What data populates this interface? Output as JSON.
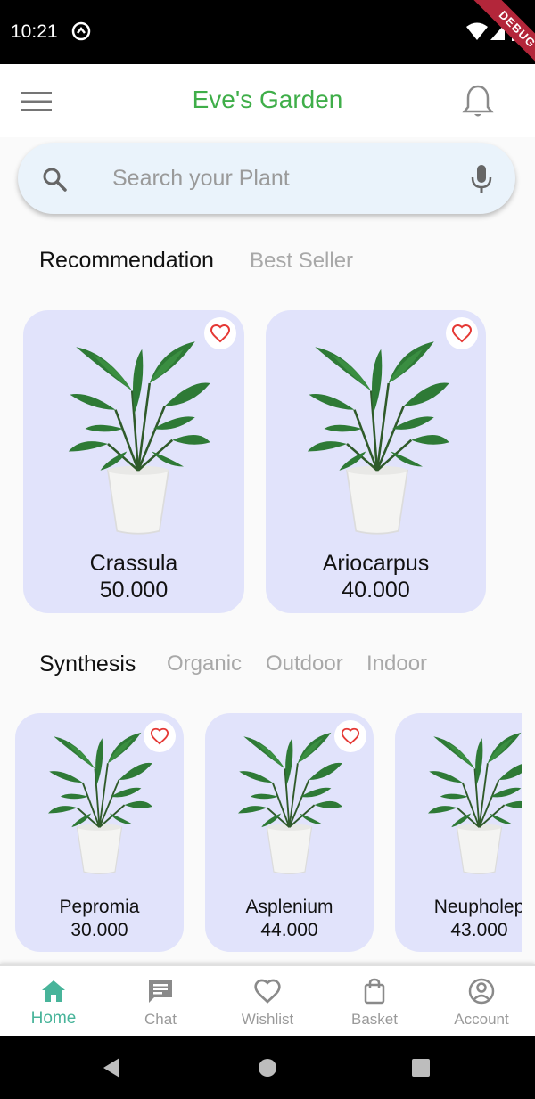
{
  "status_bar": {
    "time": "10:21",
    "debug_label": "DEBUG"
  },
  "app_bar": {
    "title": "Eve's Garden"
  },
  "search": {
    "placeholder": "Search your Plant"
  },
  "recommend_tabs": [
    {
      "label": "Recommendation",
      "active": true
    },
    {
      "label": "Best Seller",
      "active": false
    }
  ],
  "recommended": [
    {
      "name": "Crassula",
      "price": "50.000"
    },
    {
      "name": "Ariocarpus",
      "price": "40.000"
    }
  ],
  "category_tabs": [
    {
      "label": "Synthesis",
      "active": true
    },
    {
      "label": "Organic",
      "active": false
    },
    {
      "label": "Outdoor",
      "active": false
    },
    {
      "label": "Indoor",
      "active": false
    }
  ],
  "products": [
    {
      "name": "Pepromia",
      "price": "30.000"
    },
    {
      "name": "Asplenium",
      "price": "44.000"
    },
    {
      "name": "Neupholep",
      "price": "43.000"
    }
  ],
  "bottom_nav": [
    {
      "label": "Home",
      "icon": "home-icon",
      "active": true
    },
    {
      "label": "Chat",
      "icon": "chat-icon",
      "active": false
    },
    {
      "label": "Wishlist",
      "icon": "heart-icon",
      "active": false
    },
    {
      "label": "Basket",
      "icon": "bag-icon",
      "active": false
    },
    {
      "label": "Account",
      "icon": "account-icon",
      "active": false
    }
  ],
  "colors": {
    "brand_green": "#3fae49",
    "nav_active": "#48b49a",
    "card_bg": "#e1e3fb",
    "heart_red": "#e53935"
  }
}
